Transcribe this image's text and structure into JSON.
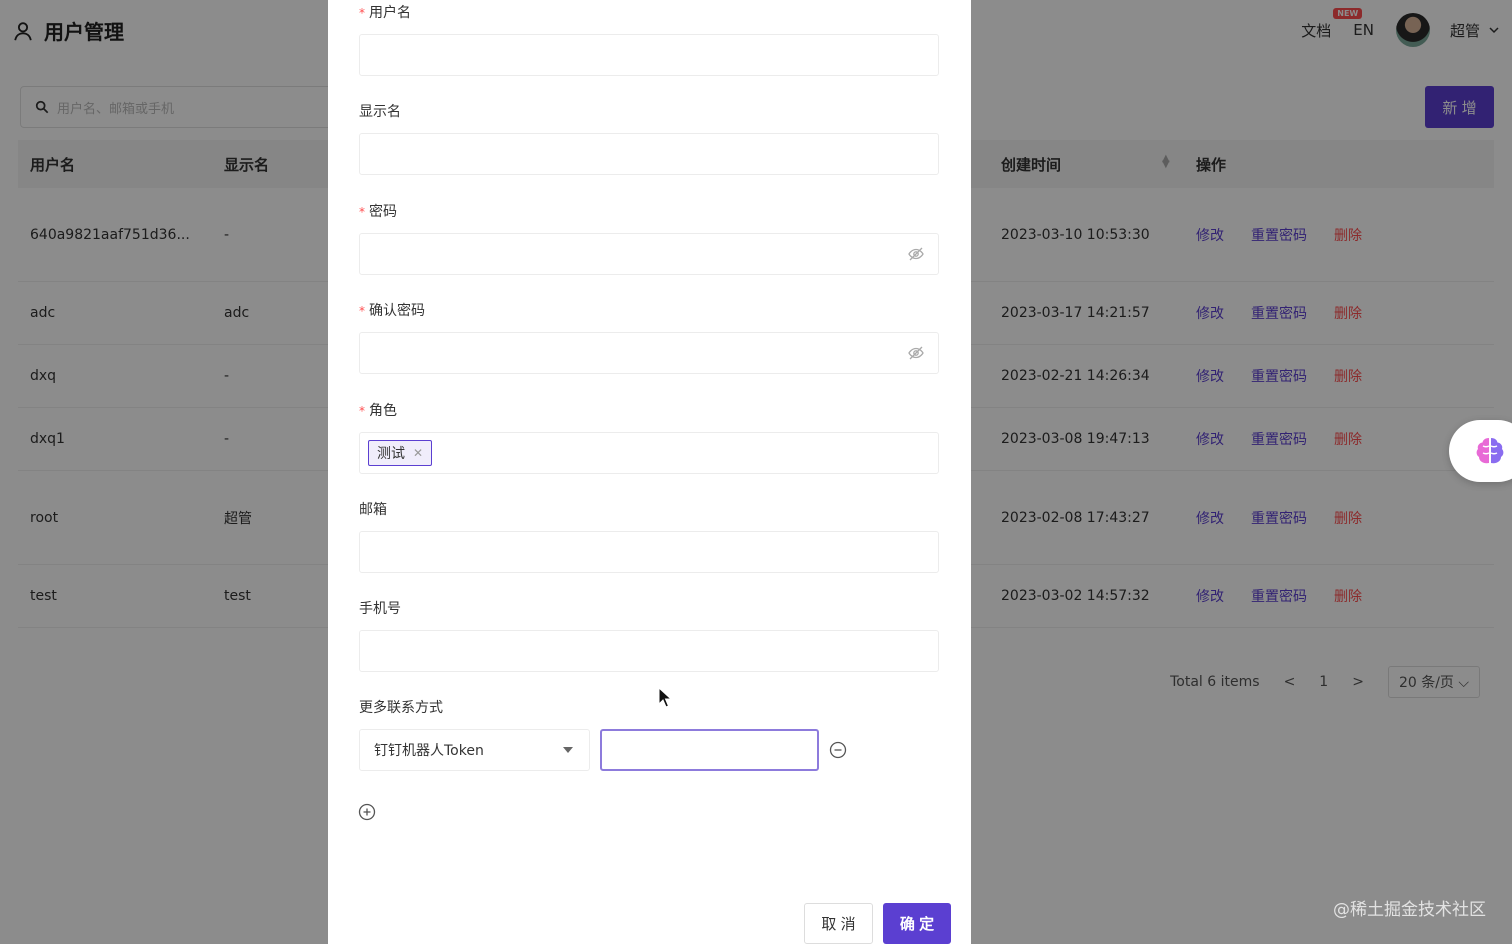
{
  "header": {
    "title": "用户管理",
    "docs_label": "文档",
    "new_badge": "NEW",
    "lang_label": "EN",
    "user_name": "超管"
  },
  "toolbar": {
    "search_placeholder": "用户名、邮箱或手机",
    "add_label": "新 增"
  },
  "table": {
    "columns": {
      "username": "用户名",
      "display_name": "显示名",
      "created_at": "创建时间",
      "actions": "操作"
    },
    "rows": [
      {
        "username": "640a9821aaf751d36...",
        "display_name": "-",
        "created_at": "2023-03-10 10:53:30"
      },
      {
        "username": "adc",
        "display_name": "adc",
        "created_at": "2023-03-17 14:21:57"
      },
      {
        "username": "dxq",
        "display_name": "-",
        "created_at": "2023-02-21 14:26:34"
      },
      {
        "username": "dxq1",
        "display_name": "-",
        "created_at": "2023-03-08 19:47:13"
      },
      {
        "username": "root",
        "display_name": "超管",
        "created_at": "2023-02-08 17:43:27"
      },
      {
        "username": "test",
        "display_name": "test",
        "created_at": "2023-03-02 14:57:32"
      }
    ],
    "action_labels": {
      "edit": "修改",
      "reset_password": "重置密码",
      "delete": "删除"
    }
  },
  "pagination": {
    "total": "Total 6 items",
    "current_page": "1",
    "page_size": "20 条/页"
  },
  "form": {
    "username_label": "用户名",
    "display_name_label": "显示名",
    "password_label": "密码",
    "confirm_password_label": "确认密码",
    "role_label": "角色",
    "role_tag": "测试",
    "email_label": "邮箱",
    "phone_label": "手机号",
    "more_contact_label": "更多联系方式",
    "contact_type_value": "钉钉机器人Token",
    "required_mark": "*"
  },
  "footer": {
    "cancel_label": "取 消",
    "ok_label": "确 定"
  },
  "watermark": "@稀土掘金技术社区",
  "colors": {
    "primary": "#5b3fd1",
    "danger": "#ff4d4f",
    "overlay": "rgba(0,0,0,0.45)"
  }
}
